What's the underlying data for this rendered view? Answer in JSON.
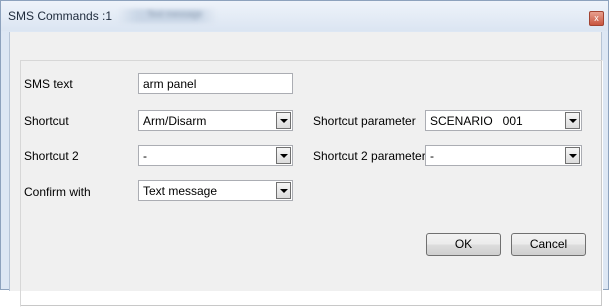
{
  "window": {
    "title": "SMS Commands :1",
    "title_secondary": "Text message",
    "close_glyph": "x"
  },
  "form": {
    "sms_text": {
      "label": "SMS text",
      "value": "arm panel"
    },
    "shortcut": {
      "label": "Shortcut",
      "value": "Arm/Disarm"
    },
    "shortcut_parameter": {
      "label": "Shortcut parameter",
      "value": "SCENARIO   001"
    },
    "shortcut2": {
      "label": "Shortcut 2",
      "value": "-"
    },
    "shortcut2_parameter": {
      "label": "Shortcut 2 parameter",
      "value": "-"
    },
    "confirm_with": {
      "label": "Confirm with",
      "value": "Text message"
    }
  },
  "buttons": {
    "ok": "OK",
    "cancel": "Cancel"
  },
  "icons": {
    "close": "close-icon",
    "dropdown": "chevron-down-icon"
  },
  "colors": {
    "close_button": "#c8553f",
    "window_frame": "#dde7f4"
  }
}
